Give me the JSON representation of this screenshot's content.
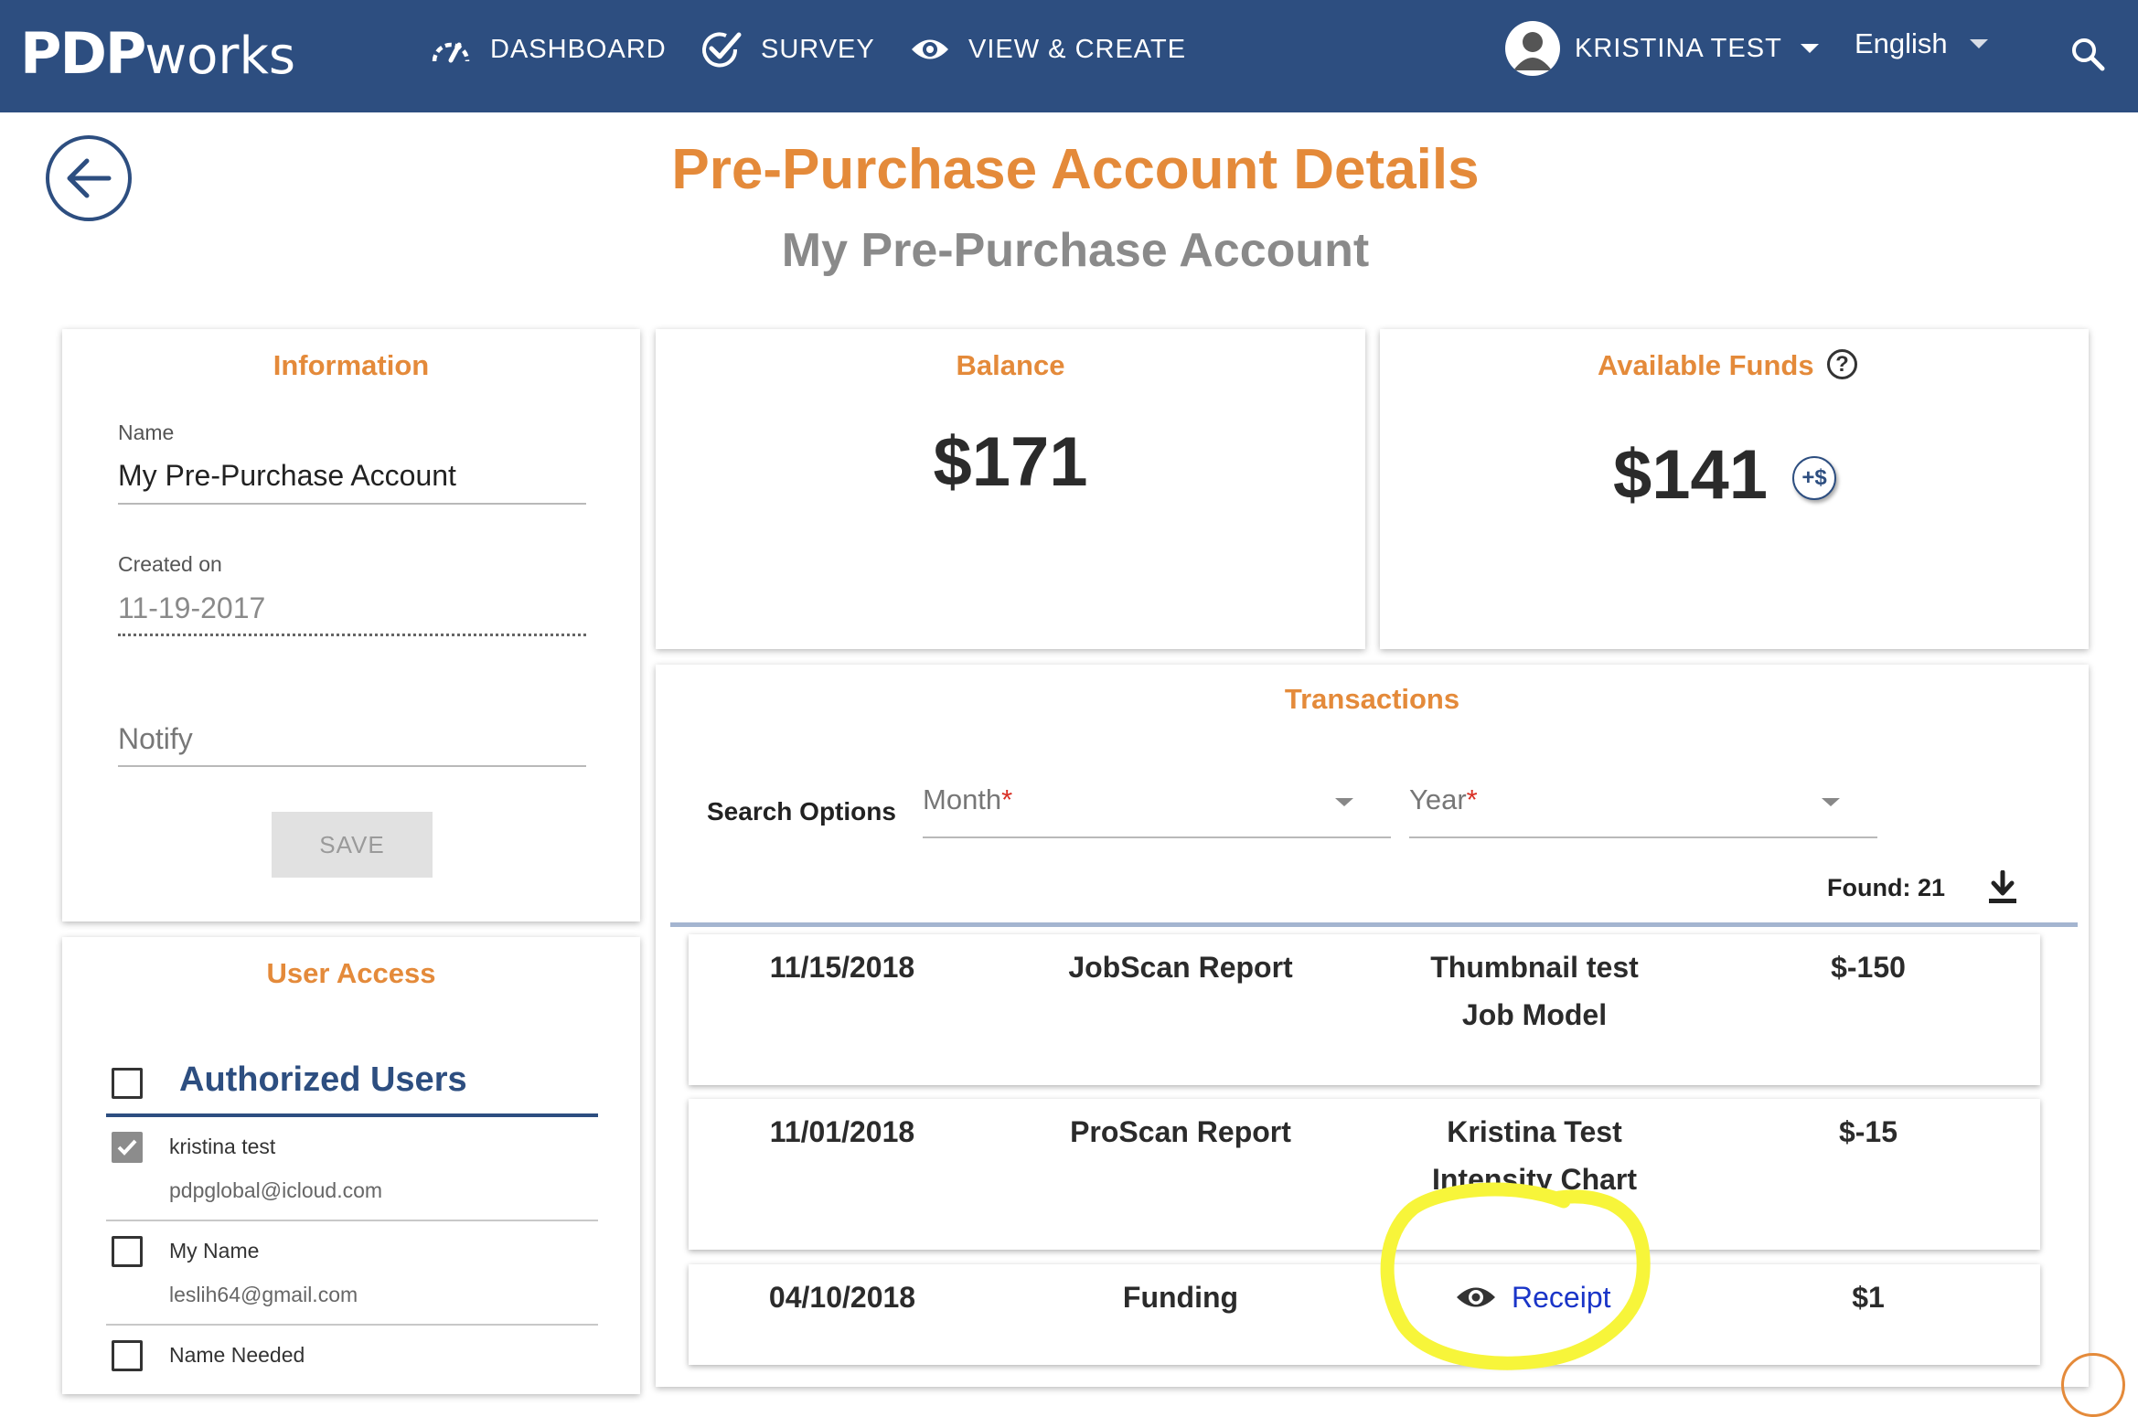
{
  "header": {
    "logo_bold": "PDP",
    "logo_light": "works",
    "nav": [
      {
        "label": "DASHBOARD",
        "icon": "speedometer-icon"
      },
      {
        "label": "SURVEY",
        "icon": "check-circle-icon"
      },
      {
        "label": "VIEW & CREATE",
        "icon": "eye-icon"
      }
    ],
    "user_name": "KRISTINA TEST",
    "language": "English"
  },
  "page": {
    "title": "Pre-Purchase Account Details",
    "subtitle": "My Pre-Purchase Account"
  },
  "information": {
    "title": "Information",
    "name_label": "Name",
    "name_value": "My Pre-Purchase Account",
    "created_label": "Created on",
    "created_value": "11-19-2017",
    "notify_placeholder": "Notify",
    "save_label": "SAVE"
  },
  "balance": {
    "title": "Balance",
    "amount": "$171"
  },
  "available_funds": {
    "title": "Available Funds",
    "help_icon": "?",
    "amount": "$141",
    "add_funds_icon": "+$"
  },
  "transactions": {
    "title": "Transactions",
    "search_label": "Search Options",
    "month_label": "Month",
    "year_label": "Year",
    "required_mark": "*",
    "found_text": "Found: 21",
    "rows": [
      {
        "date": "11/15/2018",
        "type": "JobScan Report",
        "detail_line1": "Thumbnail test",
        "detail_line2": "Job Model",
        "amount": "$-150"
      },
      {
        "date": "11/01/2018",
        "type": "ProScan Report",
        "detail_line1": "Kristina Test",
        "detail_line2": "Intensity Chart",
        "amount": "$-15"
      },
      {
        "date": "04/10/2018",
        "type": "Funding",
        "receipt_label": "Receipt",
        "amount": "$1"
      }
    ]
  },
  "user_access": {
    "title": "User Access",
    "authorized_label": "Authorized Users",
    "users": [
      {
        "name": "kristina test",
        "email": "pdpglobal@icloud.com",
        "checked": true
      },
      {
        "name": "My Name",
        "email": "leslih64@gmail.com",
        "checked": false
      },
      {
        "name": "Name Needed",
        "email": "",
        "checked": false
      }
    ]
  },
  "colors": {
    "header_bg": "#2d4e80",
    "accent_orange": "#e48a3a",
    "link_blue": "#1a35c8",
    "highlight_yellow": "#f7f53a"
  }
}
